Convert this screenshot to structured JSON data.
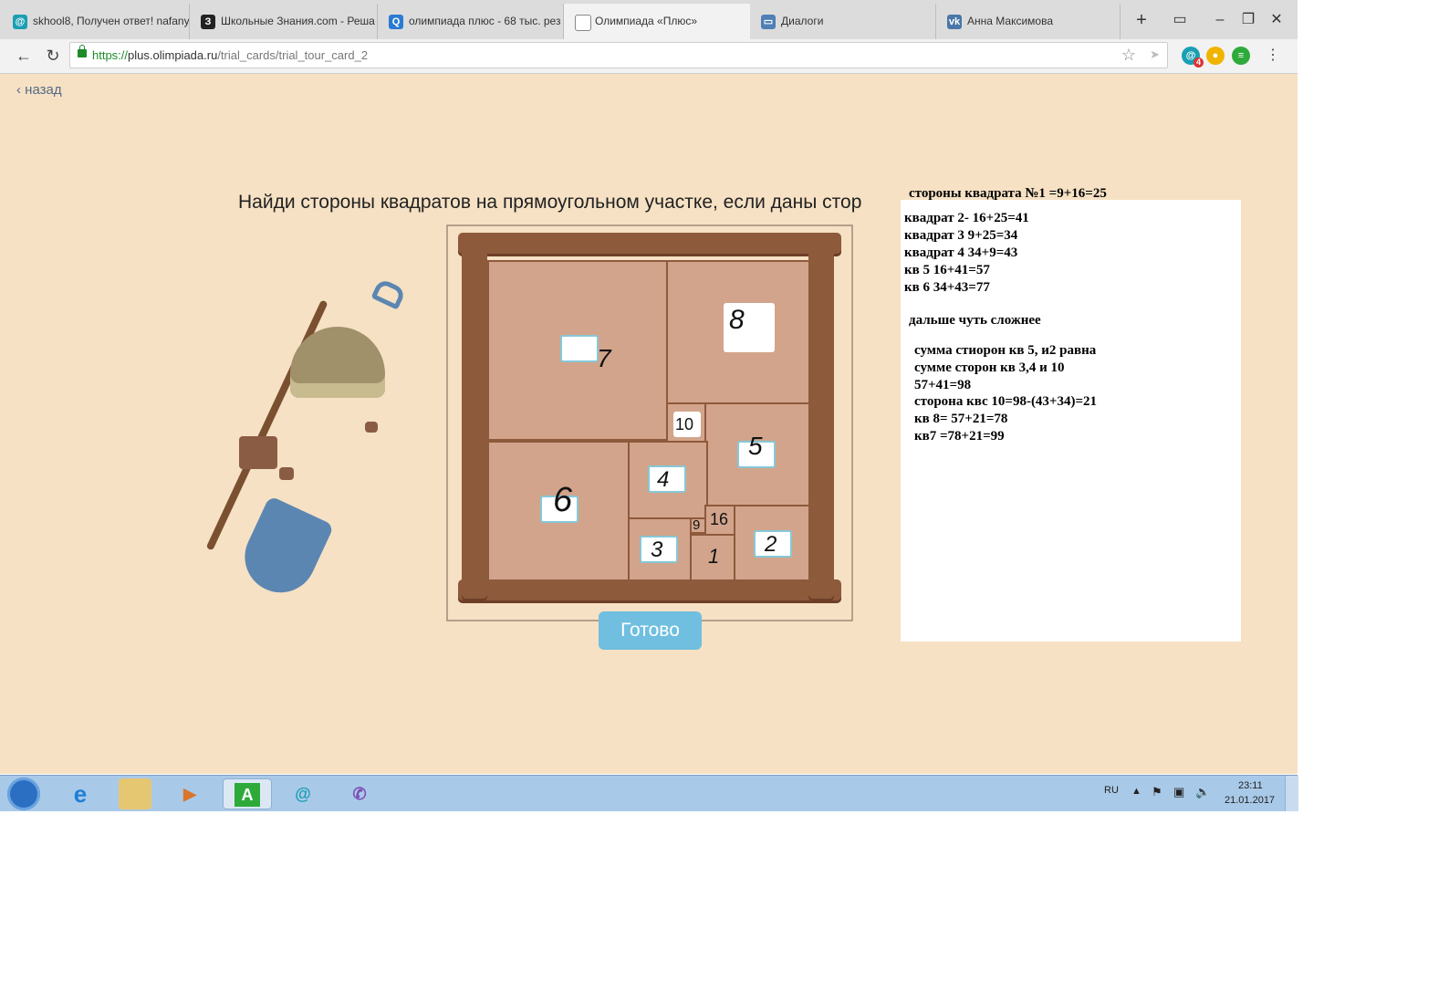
{
  "browser": {
    "tabs": [
      {
        "label": "skhool8, Получен ответ! nafany",
        "icon": "at-icon",
        "color": "#1a9fb3"
      },
      {
        "label": "Школьные Знания.com - Реша",
        "icon": "znania-icon",
        "color": "#222222"
      },
      {
        "label": "олимпиада плюс - 68 тыс. рез",
        "icon": "search-icon",
        "color": "#2a7bd1"
      },
      {
        "label": "Олимпиада «Плюс»",
        "icon": "page-icon",
        "color": "#888888"
      },
      {
        "label": "Диалоги",
        "icon": "dialog-icon",
        "color": "#4f7fb5"
      },
      {
        "label": "Анна Максимова",
        "icon": "vk-icon",
        "color": "#4a76a8"
      }
    ],
    "active_tab": 3,
    "url": {
      "protocol": "https://",
      "host": "plus.olimpiada.ru",
      "path": "/trial_cards/trial_tour_card_2"
    },
    "extension_badge": "4"
  },
  "page": {
    "back_label": "назад",
    "title": "Найди стороны квадратов на прямоугольном участке, если даны стор",
    "ready_button": "Готово",
    "given_numbers": {
      "a": "9",
      "b": "16",
      "c": "1"
    },
    "handwritten": {
      "sq1": "1",
      "sq2": "2",
      "sq3": "3",
      "sq4": "4",
      "sq5": "5",
      "sq6": "6",
      "sq7": "7",
      "sq8": "8",
      "sq10": "10"
    }
  },
  "notes": {
    "header": "стороны квадрата №1 =9+16=25",
    "lines": [
      "квадрат 2- 16+25=41",
      "квадрат 3  9+25=34",
      "квадрат 4    34+9=43",
      "кв 5      16+41=57",
      "кв  6    34+43=77",
      "дальше чуть сложнее",
      "сумма стиорон кв  5,  и2 равна",
      "сумме сторон кв 3,4 и 10",
      "57+41=98",
      "сторона квс 10=98-(43+34)=21",
      "кв 8=  57+21=78",
      "кв7 =78+21=99"
    ]
  },
  "taskbar": {
    "lang": "RU",
    "time": "23:11",
    "date": "21.01.2017"
  }
}
